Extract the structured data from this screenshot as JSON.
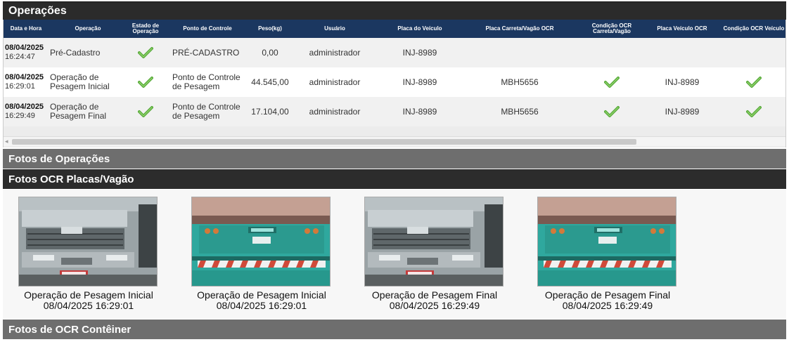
{
  "panel": {
    "title": "Operações"
  },
  "table": {
    "headers": [
      "Data e Hora",
      "Operação",
      "Estado de Operação",
      "Ponto de Controle",
      "Peso(kg)",
      "Usuário",
      "Placa do Veículo",
      "Placa Carreta/Vagão OCR",
      "Condição OCR Carreta/Vagão",
      "Placa Veículo OCR",
      "Condição OCR Veículo"
    ],
    "rows": [
      {
        "date": "08/04/2025",
        "time": "16:24:47",
        "operacao": "Pré-Cadastro",
        "estado": true,
        "ponto": "PRÉ-CADASTRO",
        "peso": "0,00",
        "usuario": "administrador",
        "placa": "INJ-8989",
        "carreta": "",
        "cond_carreta": false,
        "placa_ocr": "",
        "cond_veiculo": false
      },
      {
        "date": "08/04/2025",
        "time": "16:29:01",
        "operacao": "Operação de Pesagem Inicial",
        "estado": true,
        "ponto": "Ponto de Controle de Pesagem",
        "peso": "44.545,00",
        "usuario": "administrador",
        "placa": "INJ-8989",
        "carreta": "MBH5656",
        "cond_carreta": true,
        "placa_ocr": "INJ-8989",
        "cond_veiculo": true
      },
      {
        "date": "08/04/2025",
        "time": "16:29:49",
        "operacao": "Operação de Pesagem Final",
        "estado": true,
        "ponto": "Ponto de Controle de Pesagem",
        "peso": "17.104,00",
        "usuario": "administrador",
        "placa": "INJ-8989",
        "carreta": "MBH5656",
        "cond_carreta": true,
        "placa_ocr": "INJ-8989",
        "cond_veiculo": true
      }
    ]
  },
  "sections": {
    "fotos_operacoes": "Fotos de Operações",
    "fotos_ocr_placas": "Fotos OCR Placas/Vagão",
    "fotos_ocr_conteiner": "Fotos de OCR Contêiner"
  },
  "photos": [
    {
      "kind": "front",
      "caption1": "Operação de Pesagem Inicial",
      "caption2": "08/04/2025 16:29:01"
    },
    {
      "kind": "rear",
      "caption1": "Operação de Pesagem Inicial",
      "caption2": "08/04/2025 16:29:01"
    },
    {
      "kind": "front",
      "caption1": "Operação de Pesagem Final",
      "caption2": "08/04/2025 16:29:49"
    },
    {
      "kind": "rear",
      "caption1": "Operação de Pesagem Final",
      "caption2": "08/04/2025 16:29:49"
    }
  ],
  "colors": {
    "header_bg": "#1b3760",
    "check": "#55a838"
  },
  "icons": {
    "check": "check-icon"
  }
}
